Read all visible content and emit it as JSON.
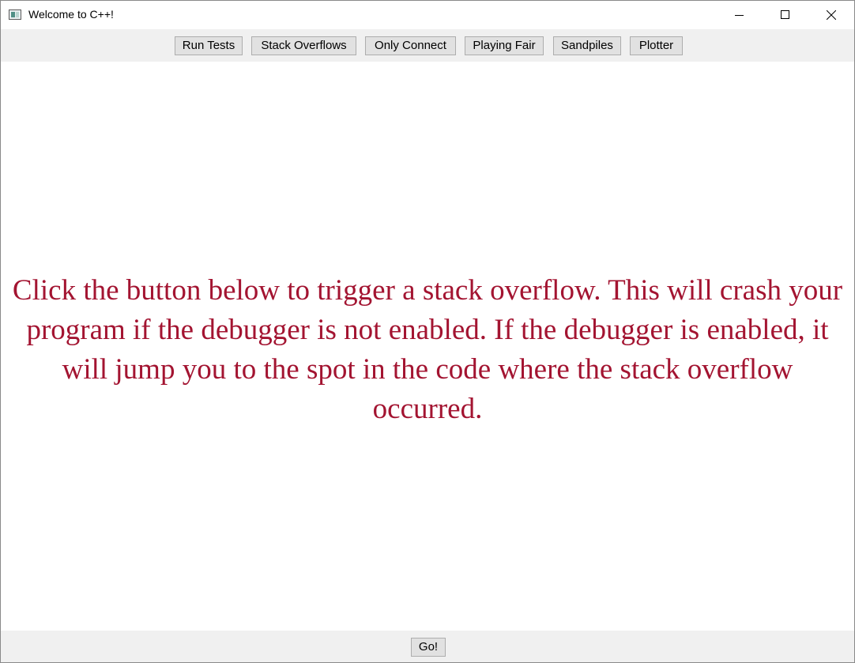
{
  "window": {
    "title": "Welcome to C++!"
  },
  "toolbar": {
    "buttons": [
      {
        "label": "Run Tests"
      },
      {
        "label": "Stack Overflows"
      },
      {
        "label": "Only Connect"
      },
      {
        "label": "Playing Fair"
      },
      {
        "label": "Sandpiles"
      },
      {
        "label": "Plotter"
      }
    ]
  },
  "main": {
    "message": "Click the button below to trigger a stack overflow. This will crash your program if the debugger is not enabled. If the debugger is enabled, it will jump you to the spot in the code where the stack overflow occurred.",
    "message_color": "#a31431"
  },
  "bottom": {
    "go_label": "Go!"
  },
  "icons": {
    "app": "app-window-icon",
    "minimize": "minimize-icon",
    "maximize": "maximize-icon",
    "close": "close-icon"
  }
}
